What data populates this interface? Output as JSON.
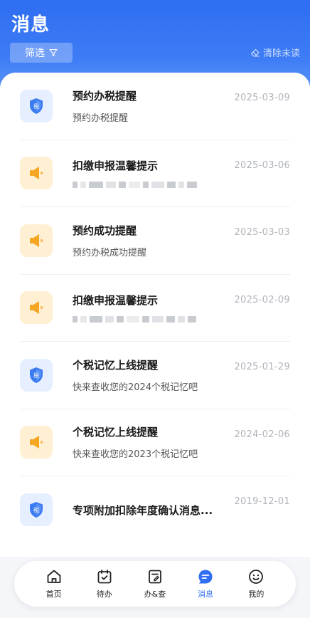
{
  "header": {
    "title": "消息",
    "filter_label": "筛选",
    "clear_label": "清除未读"
  },
  "messages": [
    {
      "title": "预约办税提醒",
      "subtitle": "预约办税提醒",
      "date": "2025-03-09",
      "icon": "tax-shield-icon"
    },
    {
      "title": "扣缴申报温馨提示",
      "subtitle": "",
      "date": "2025-03-06",
      "icon": "speaker-icon"
    },
    {
      "title": "预约成功提醒",
      "subtitle": "预约办税成功提醒",
      "date": "2025-03-03",
      "icon": "speaker-icon"
    },
    {
      "title": "扣缴申报温馨提示",
      "subtitle": "",
      "date": "2025-02-09",
      "icon": "speaker-icon"
    },
    {
      "title": "个税记忆上线提醒",
      "subtitle": "快来查收您的2024个税记忆吧",
      "date": "2025-01-29",
      "icon": "tax-shield-icon"
    },
    {
      "title": "个税记忆上线提醒",
      "subtitle": "快来查收您的2023个税记忆吧",
      "date": "2024-02-06",
      "icon": "speaker-icon"
    },
    {
      "title": "专项附加扣除年度确认消息...",
      "subtitle": "",
      "date": "2019-12-01",
      "icon": "tax-shield-icon"
    }
  ],
  "tabbar": {
    "tabs": [
      {
        "label": "首页",
        "icon": "home-icon"
      },
      {
        "label": "待办",
        "icon": "calendar-check-icon"
      },
      {
        "label": "办&查",
        "icon": "document-edit-icon"
      },
      {
        "label": "消息",
        "icon": "message-icon",
        "active": true
      },
      {
        "label": "我的",
        "icon": "smile-icon"
      }
    ]
  },
  "colors": {
    "primary": "#2f6df2",
    "tax_icon_bg": "#e6efff",
    "speaker_icon_bg": "#fff0d4",
    "speaker_icon": "#f5a623"
  }
}
